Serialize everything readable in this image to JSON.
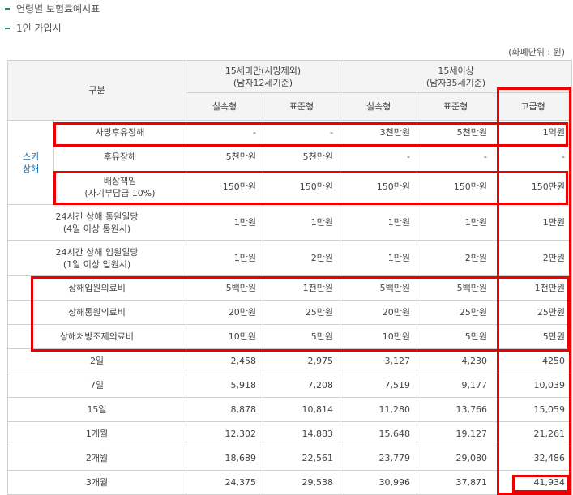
{
  "headings": {
    "title": "연령별 보험료예시표",
    "subtitle": "1인 가입시"
  },
  "unit_note": "(화폐단위 : 원)",
  "header": {
    "category": "구분",
    "group_a": [
      "15세미만(사망제외)",
      "(남자12세기준)"
    ],
    "group_b": [
      "15세이상",
      "(남자35세기준)"
    ],
    "plans": [
      "실속형",
      "표준형",
      "실속형",
      "표준형",
      "고급형"
    ]
  },
  "side_category": [
    "스키",
    "상해"
  ],
  "coverage_rows": [
    {
      "label": [
        "사망후유장해"
      ],
      "values": [
        "-",
        "-",
        "3천만원",
        "5천만원",
        "1억원"
      ]
    },
    {
      "label": [
        "후유장해"
      ],
      "values": [
        "5천만원",
        "5천만원",
        "-",
        "-",
        "-"
      ]
    },
    {
      "label": [
        "배상책임",
        "(자기부담금 10%)"
      ],
      "values": [
        "150만원",
        "150만원",
        "150만원",
        "150만원",
        "150만원"
      ]
    },
    {
      "label": [
        "24시간 상해 통원일당",
        "(4일 이상 통원시)"
      ],
      "values": [
        "1만원",
        "1만원",
        "1만원",
        "1만원",
        "1만원"
      ]
    },
    {
      "label": [
        "24시간 상해 입원일당",
        "(1일 이상 입원시)"
      ],
      "values": [
        "1만원",
        "2만원",
        "1만원",
        "2만원",
        "2만원"
      ]
    },
    {
      "label": [
        "상해입원의료비"
      ],
      "values": [
        "5백만원",
        "1천만원",
        "5백만원",
        "5백만원",
        "1천만원"
      ]
    },
    {
      "label": [
        "상해통원의료비"
      ],
      "values": [
        "20만원",
        "25만원",
        "20만원",
        "25만원",
        "25만원"
      ]
    },
    {
      "label": [
        "상해처방조제의료비"
      ],
      "values": [
        "10만원",
        "5만원",
        "10만원",
        "5만원",
        "5만원"
      ]
    }
  ],
  "premium_rows": [
    {
      "period": "2일",
      "values": [
        "2,458",
        "2,975",
        "3,127",
        "4,230",
        "4250"
      ]
    },
    {
      "period": "7일",
      "values": [
        "5,918",
        "7,208",
        "7,519",
        "9,177",
        "10,039"
      ]
    },
    {
      "period": "15일",
      "values": [
        "8,878",
        "10,814",
        "11,280",
        "13,766",
        "15,059"
      ]
    },
    {
      "period": "1개월",
      "values": [
        "12,302",
        "14,883",
        "15,648",
        "19,127",
        "21,261"
      ]
    },
    {
      "period": "2개월",
      "values": [
        "18,689",
        "22,561",
        "23,779",
        "29,080",
        "32,486"
      ]
    },
    {
      "period": "3개월",
      "values": [
        "24,375",
        "29,538",
        "30,996",
        "37,871",
        "41,934"
      ]
    }
  ],
  "colors": {
    "highlight": "#ee0000",
    "header_bg": "#f4f4f4",
    "category_text": "#1f6aa8",
    "heading_marker": "#1c8a7a"
  }
}
